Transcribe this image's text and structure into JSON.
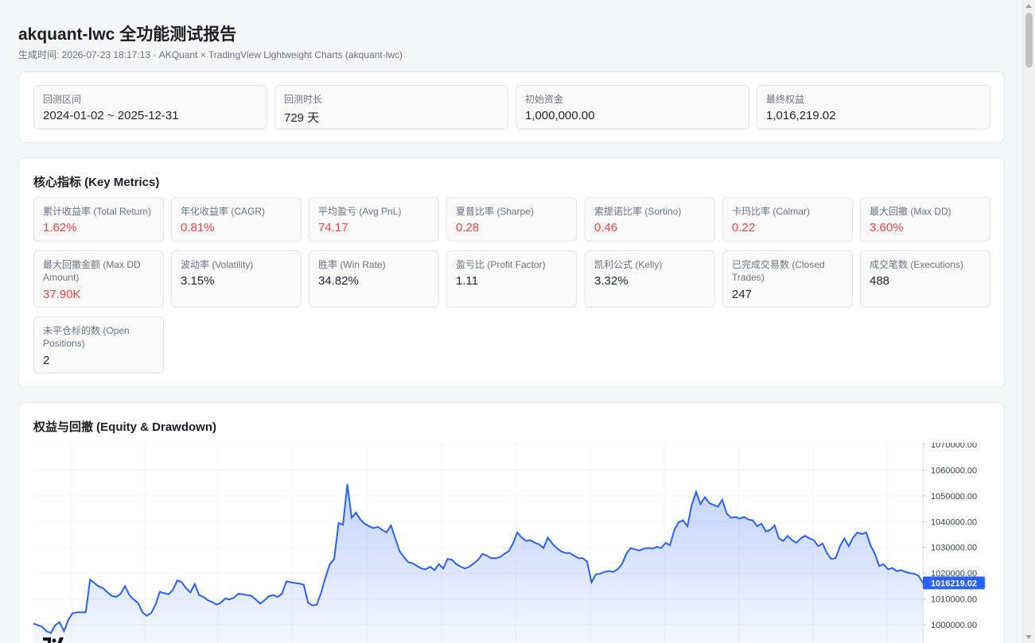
{
  "header": {
    "title": "akquant-lwc 全功能测试报告",
    "subtitle": "生成时间: 2026-07-23 18:17:13 · AKQuant × TradingView Lightweight Charts (akquant-lwc)"
  },
  "summary": [
    {
      "label": "回测区间",
      "value": "2024-01-02 ~ 2025-12-31"
    },
    {
      "label": "回测时长",
      "value": "729 天"
    },
    {
      "label": "初始资金",
      "value": "1,000,000.00"
    },
    {
      "label": "最终权益",
      "value": "1,016,219.02"
    }
  ],
  "metrics": {
    "title": "核心指标 (Key Metrics)",
    "items": [
      {
        "label": "累计收益率 (Total Return)",
        "value": "1.62%",
        "tone": "red"
      },
      {
        "label": "年化收益率 (CAGR)",
        "value": "0.81%",
        "tone": "red"
      },
      {
        "label": "平均盈亏 (Avg PnL)",
        "value": "74.17",
        "tone": "red"
      },
      {
        "label": "夏普比率 (Sharpe)",
        "value": "0.28",
        "tone": "red"
      },
      {
        "label": "索提诺比率 (Sortino)",
        "value": "0.46",
        "tone": "red"
      },
      {
        "label": "卡玛比率 (Calmar)",
        "value": "0.22",
        "tone": "red"
      },
      {
        "label": "最大回撤 (Max DD)",
        "value": "3.60%",
        "tone": "red"
      },
      {
        "label": "最大回撤金额 (Max DD Amount)",
        "value": "37.90K",
        "tone": "red"
      },
      {
        "label": "波动率 (Volatility)",
        "value": "3.15%",
        "tone": "normal"
      },
      {
        "label": "胜率 (Win Rate)",
        "value": "34.82%",
        "tone": "normal"
      },
      {
        "label": "盈亏比 (Profit Factor)",
        "value": "1.11",
        "tone": "normal"
      },
      {
        "label": "凯利公式 (Kelly)",
        "value": "3.32%",
        "tone": "normal"
      },
      {
        "label": "已完成交易数 (Closed Trades)",
        "value": "247",
        "tone": "normal"
      },
      {
        "label": "成交笔数 (Executions)",
        "value": "488",
        "tone": "normal"
      },
      {
        "label": "未平仓标的数 (Open Positions)",
        "value": "2",
        "tone": "normal"
      }
    ]
  },
  "equity": {
    "title": "权益与回撤 (Equity & Drawdown)",
    "last_value_label": "1016219.02"
  },
  "colors": {
    "red": "#ef4444",
    "line": "#2962ff",
    "badge": "#2962ff"
  },
  "chart_data": {
    "type": "area",
    "title": "权益与回撤 (Equity & Drawdown)",
    "ylim": [
      995000,
      1070000
    ],
    "y_ticks": [
      "1000000.00",
      "1010000.00",
      "1020000.00",
      "1030000.00",
      "1040000.00",
      "1050000.00",
      "1060000.00",
      "1070000.00"
    ],
    "y_tick_values": [
      1000000,
      1010000,
      1020000,
      1030000,
      1040000,
      1050000,
      1060000,
      1070000
    ],
    "grid": true,
    "series": [
      {
        "values": [
          1000500,
          999800,
          999200,
          997500,
          996800,
          999800,
          1001000,
          997500,
          1001800,
          1004500,
          1004800,
          1004800,
          1004800,
          1017500,
          1016200,
          1014800,
          1014200,
          1012500,
          1011200,
          1010800,
          1012000,
          1015000,
          1011500,
          1009800,
          1008500,
          1004800,
          1003500,
          1004500,
          1007800,
          1012800,
          1012200,
          1011800,
          1013500,
          1017200,
          1016500,
          1014200,
          1012500,
          1015800,
          1011500,
          1010800,
          1009500,
          1008800,
          1007800,
          1008500,
          1010200,
          1009800,
          1010500,
          1012000,
          1011800,
          1011500,
          1011200,
          1009800,
          1008200,
          1009500,
          1011000,
          1011500,
          1010800,
          1012000,
          1016800,
          1016500,
          1016200,
          1016000,
          1015500,
          1008500,
          1007500,
          1007800,
          1012500,
          1018500,
          1023500,
          1025500,
          1039500,
          1038800,
          1054500,
          1041500,
          1043500,
          1040800,
          1039200,
          1038200,
          1037500,
          1038000,
          1036800,
          1035800,
          1038500,
          1033500,
          1028500,
          1026200,
          1024200,
          1023800,
          1022800,
          1021800,
          1021500,
          1022500,
          1021200,
          1023500,
          1021800,
          1025500,
          1025200,
          1023500,
          1022500,
          1021800,
          1022500,
          1023800,
          1025200,
          1027500,
          1026800,
          1025800,
          1025800,
          1026200,
          1027500,
          1028500,
          1031500,
          1035800,
          1033800,
          1032500,
          1032800,
          1031800,
          1031200,
          1029800,
          1033800,
          1031500,
          1029800,
          1028500,
          1027800,
          1027800,
          1026800,
          1025800,
          1025800,
          1024500,
          1016500,
          1019500,
          1019800,
          1020500,
          1020800,
          1020500,
          1021500,
          1023500,
          1027500,
          1029800,
          1029200,
          1028800,
          1029500,
          1029800,
          1029500,
          1030200,
          1029800,
          1031800,
          1030800,
          1036800,
          1039800,
          1040500,
          1038200,
          1046500,
          1051500,
          1046800,
          1049500,
          1047200,
          1046500,
          1045800,
          1048500,
          1043200,
          1041500,
          1041800,
          1041200,
          1041800,
          1040800,
          1040500,
          1038200,
          1039200,
          1036200,
          1036800,
          1038500,
          1033500,
          1032500,
          1034500,
          1032800,
          1031800,
          1033500,
          1034500,
          1033500,
          1032800,
          1030500,
          1031500,
          1027800,
          1025500,
          1025800,
          1030500,
          1033500,
          1030500,
          1033800,
          1035800,
          1035200,
          1035800,
          1030800,
          1027500,
          1022800,
          1023500,
          1021500,
          1022000,
          1020800,
          1021200,
          1020500,
          1020000,
          1019800,
          1019000,
          1016219
        ]
      }
    ]
  }
}
